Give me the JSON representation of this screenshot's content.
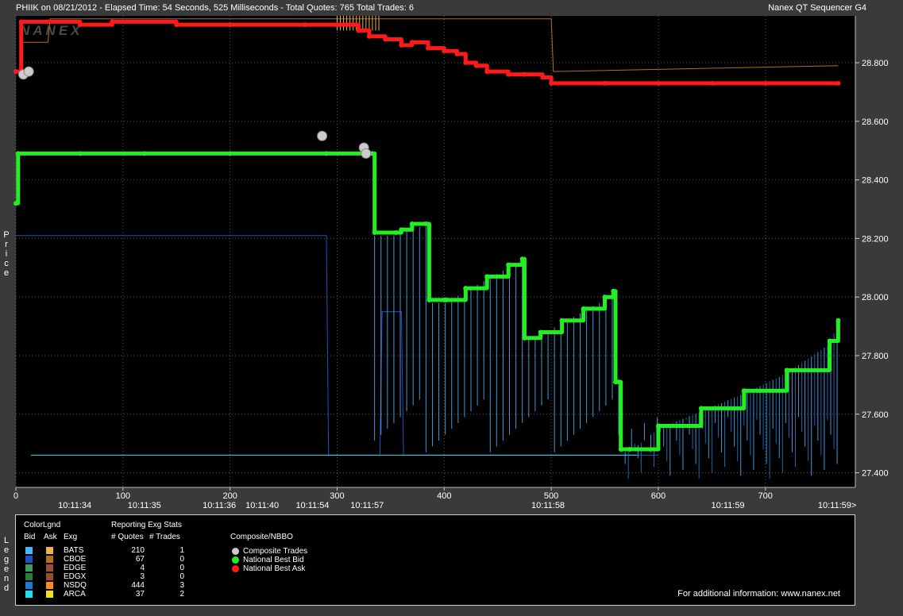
{
  "header": {
    "title": "PHIIK on 08/21/2012  -  Elapsed Time: 54 Seconds, 525 Milliseconds  -  Total Quotes: 765  Total Trades: 6",
    "app": "Nanex QT Sequencer G4",
    "watermark": "NANEX"
  },
  "chart_data": {
    "type": "line",
    "ylabel": "Price",
    "ylim": [
      27.35,
      28.96
    ],
    "xlim": [
      0,
      784
    ],
    "y_ticks": [
      "28.800",
      "28.600",
      "28.400",
      "28.200",
      "28.000",
      "27.800",
      "27.600",
      "27.400"
    ],
    "x_ticks": [
      {
        "at": 0,
        "label": "0"
      },
      {
        "at": 100,
        "label": "100"
      },
      {
        "at": 200,
        "label": "200"
      },
      {
        "at": 300,
        "label": "300"
      },
      {
        "at": 400,
        "label": "400"
      },
      {
        "at": 500,
        "label": "500"
      },
      {
        "at": 600,
        "label": "600"
      },
      {
        "at": 700,
        "label": "700"
      }
    ],
    "time_ticks": [
      {
        "at": 55,
        "label": "10:11:34"
      },
      {
        "at": 120,
        "label": "10:11:35"
      },
      {
        "at": 190,
        "label": "10:11:36"
      },
      {
        "at": 230,
        "label": "10:11:40"
      },
      {
        "at": 277,
        "label": "10:11:54"
      },
      {
        "at": 328,
        "label": "10:11:57"
      },
      {
        "at": 497,
        "label": "10:11:58"
      },
      {
        "at": 665,
        "label": "10:11:59"
      },
      {
        "at": 767,
        "label": "10:11:59>"
      }
    ],
    "grid": true,
    "series": [
      {
        "name": "National Best Ask",
        "color": "#ff1a1a",
        "points": [
          [
            0,
            28.77
          ],
          [
            5,
            28.94
          ],
          [
            30,
            28.94
          ],
          [
            60,
            28.93
          ],
          [
            90,
            28.94
          ],
          [
            150,
            28.93
          ],
          [
            200,
            28.93
          ],
          [
            270,
            28.93
          ],
          [
            300,
            28.93
          ],
          [
            320,
            28.91
          ],
          [
            330,
            28.89
          ],
          [
            345,
            28.88
          ],
          [
            360,
            28.86
          ],
          [
            370,
            28.87
          ],
          [
            385,
            28.85
          ],
          [
            400,
            28.84
          ],
          [
            412,
            28.83
          ],
          [
            420,
            28.8
          ],
          [
            430,
            28.79
          ],
          [
            440,
            28.77
          ],
          [
            460,
            28.76
          ],
          [
            475,
            28.76
          ],
          [
            492,
            28.75
          ],
          [
            500,
            28.73
          ],
          [
            550,
            28.73
          ],
          [
            600,
            28.73
          ],
          [
            650,
            28.73
          ],
          [
            700,
            28.73
          ],
          [
            768,
            28.73
          ]
        ]
      },
      {
        "name": "National Best Bid",
        "color": "#22ee22",
        "points": [
          [
            0,
            28.32
          ],
          [
            2,
            28.49
          ],
          [
            60,
            28.49
          ],
          [
            120,
            28.49
          ],
          [
            200,
            28.49
          ],
          [
            290,
            28.49
          ],
          [
            333,
            28.49
          ],
          [
            335,
            28.22
          ],
          [
            355,
            28.22
          ],
          [
            360,
            28.23
          ],
          [
            370,
            28.25
          ],
          [
            383,
            28.25
          ],
          [
            386,
            27.99
          ],
          [
            400,
            27.99
          ],
          [
            402,
            27.99
          ],
          [
            420,
            28.03
          ],
          [
            440,
            28.07
          ],
          [
            460,
            28.11
          ],
          [
            473,
            28.13
          ],
          [
            475,
            27.86
          ],
          [
            490,
            27.88
          ],
          [
            510,
            27.92
          ],
          [
            530,
            27.96
          ],
          [
            550,
            28.0
          ],
          [
            558,
            28.02
          ],
          [
            560,
            27.71
          ],
          [
            563,
            27.71
          ],
          [
            565,
            27.48
          ],
          [
            573,
            27.48
          ],
          [
            600,
            27.56
          ],
          [
            640,
            27.62
          ],
          [
            680,
            27.68
          ],
          [
            720,
            27.75
          ],
          [
            760,
            27.85
          ],
          [
            768,
            27.92
          ]
        ]
      },
      {
        "name": "Composite Trades",
        "color": "#cccccc",
        "points": [
          [
            7,
            28.76
          ],
          [
            12,
            28.77
          ],
          [
            286,
            28.55
          ],
          [
            325,
            28.51
          ],
          [
            327,
            28.49
          ]
        ]
      }
    ]
  },
  "legend": {
    "color_header": "ColorLgnd",
    "bid_label": "Bid",
    "ask_label": "Ask",
    "exg_label": "Exg",
    "stats_header": "Reporting Exg Stats",
    "quotes_label": "# Quotes",
    "trades_label": "# Trades",
    "composite_header": "Composite/NBBO",
    "exchanges": [
      {
        "name": "BATS",
        "quotes": "210",
        "trades": "1",
        "bid_color": "#4ab4ff",
        "ask_color": "#f0b050"
      },
      {
        "name": "CBOE",
        "quotes": "67",
        "trades": "0",
        "bid_color": "#2050c0",
        "ask_color": "#b07020"
      },
      {
        "name": "EDGE",
        "quotes": "4",
        "trades": "0",
        "bid_color": "#3c9c5c",
        "ask_color": "#9c4c3c"
      },
      {
        "name": "EDGX",
        "quotes": "3",
        "trades": "0",
        "bid_color": "#2c7c3c",
        "ask_color": "#9c4c2c"
      },
      {
        "name": "NSDQ",
        "quotes": "444",
        "trades": "3",
        "bid_color": "#1c7cd4",
        "ask_color": "#ff8c1a"
      },
      {
        "name": "ARCA",
        "quotes": "37",
        "trades": "2",
        "bid_color": "#22e0f0",
        "ask_color": "#f0e020"
      }
    ],
    "composite": [
      {
        "name": "Composite Trades",
        "color": "#cccccc"
      },
      {
        "name": "National Best Bid",
        "color": "#22ee22"
      },
      {
        "name": "National Best Ask",
        "color": "#ff1a1a"
      }
    ],
    "side_label": "Legend",
    "info": "For additional information: www.nanex.net"
  }
}
